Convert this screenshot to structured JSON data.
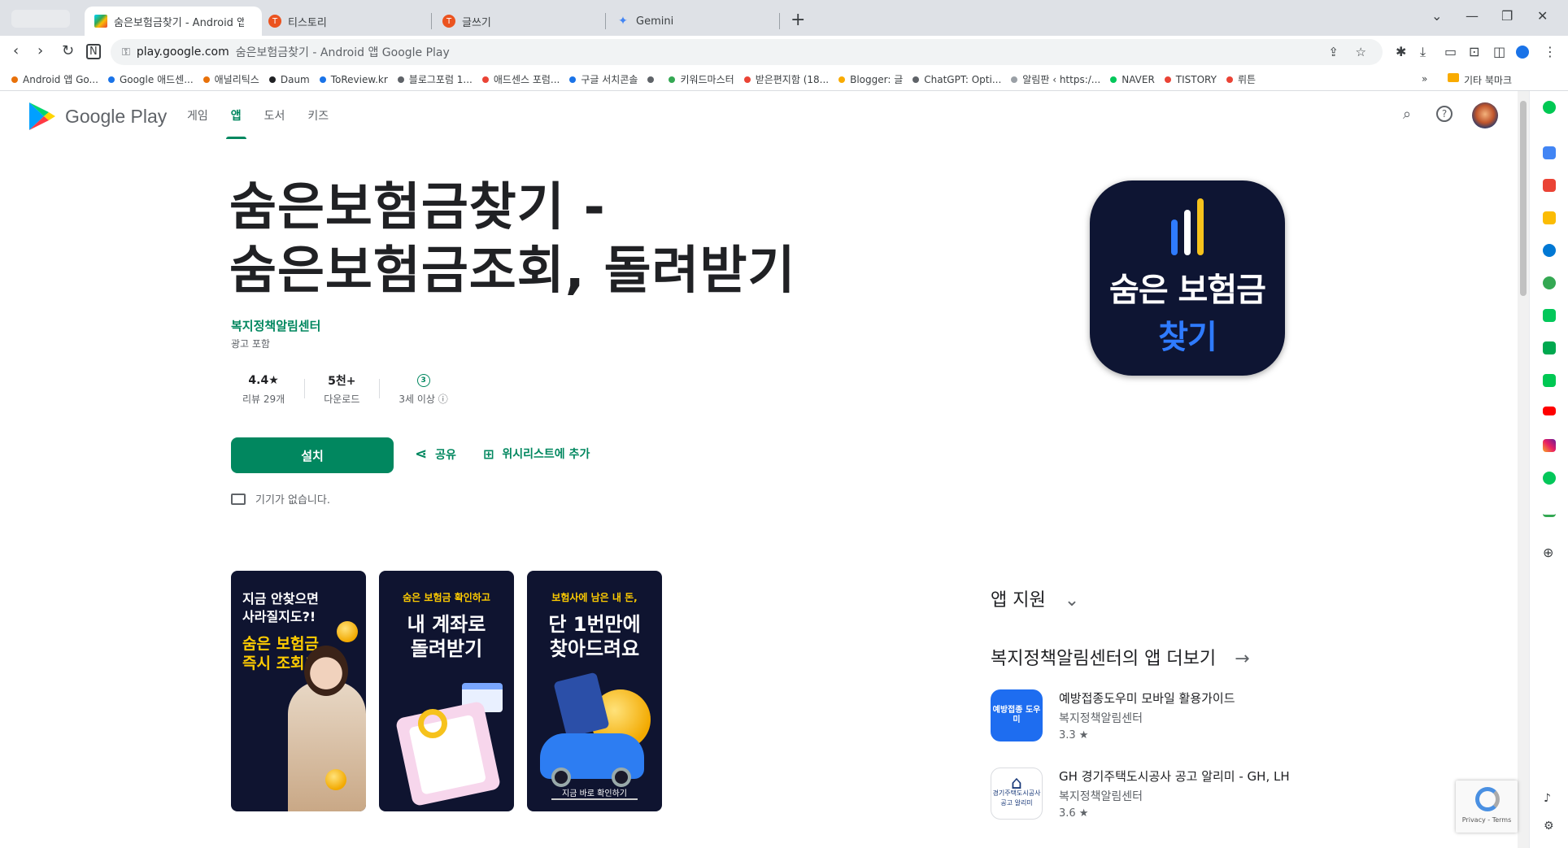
{
  "tabs": [
    {
      "title": "숨은보험금찾기 - Android 앱 Go",
      "active": true
    },
    {
      "title": "티스토리",
      "active": false
    },
    {
      "title": "글쓰기",
      "active": false
    },
    {
      "title": "Gemini",
      "active": false
    }
  ],
  "address": {
    "host": "play.google.com",
    "rest": "숨은보험금찾기 - Android 앱 Google Play"
  },
  "bookmarks": [
    {
      "label": "Android 앱 Go...",
      "color": "#e8710a"
    },
    {
      "label": "Google 애드센...",
      "color": "#1a73e8"
    },
    {
      "label": "애널리틱스",
      "color": "#e8710a"
    },
    {
      "label": "Daum",
      "color": "#202124"
    },
    {
      "label": "ToReview.kr",
      "color": "#1a73e8"
    },
    {
      "label": "블로그포럼 1...",
      "color": "#5f6368"
    },
    {
      "label": "애드센스 포럼...",
      "color": "#ea4335"
    },
    {
      "label": "구글 서치콘솔",
      "color": "#1a73e8"
    },
    {
      "label": "",
      "color": "#5f6368"
    },
    {
      "label": "키워드마스터",
      "color": "#34a853"
    },
    {
      "label": "받은편지함 (18...",
      "color": "#ea4335"
    },
    {
      "label": "Blogger: 글",
      "color": "#f9ab00"
    },
    {
      "label": "ChatGPT: Opti...",
      "color": "#5f6368"
    },
    {
      "label": "알림판 ‹ https:/...",
      "color": "#9aa0a6"
    },
    {
      "label": "NAVER",
      "color": "#03c75a"
    },
    {
      "label": "TISTORY",
      "color": "#ea4335"
    },
    {
      "label": "뤼튼",
      "color": "#ea4335"
    }
  ],
  "bookmarks_more": "»",
  "bookmarks_folder": "기타 북마크",
  "header": {
    "logo_text": "Google Play",
    "nav": [
      "게임",
      "앱",
      "도서",
      "키즈"
    ],
    "active_nav": "앱"
  },
  "app": {
    "title_line1": "숨은보험금찾기 -",
    "title_line2": "숨은보험금조회, 돌려받기",
    "developer": "복지정책알림센터",
    "contains_ads": "광고 포함",
    "rating": "4.4★",
    "reviews": "리뷰 29개",
    "downloads": "5천+",
    "downloads_label": "다운로드",
    "age_badge": "3",
    "age": "3세 이상 ⓘ",
    "install": "설치",
    "share": "공유",
    "wishlist": "위시리스트에 추가",
    "no_devices": "기기가 없습니다.",
    "icon_line1": "숨은 보험금",
    "icon_line2": "찾기"
  },
  "screenshots": [
    {
      "line1": "지금 안찾으면",
      "line2": "사라질지도?!",
      "hl1": "숨은 보험금",
      "hl2": "즉시 조회!"
    },
    {
      "sub": "숨은 보험금 확인하고",
      "big1": "내 계좌로",
      "big2": "돌려받기"
    },
    {
      "sub": "보험사에 남은 내 돈,",
      "big1": "단 1번만에",
      "big2": "찾아드려요",
      "cta": "지금 바로 확인하기"
    }
  ],
  "side": {
    "support": "앱 지원",
    "more_from": "복지정책알림센터의 앱 더보기",
    "related": [
      {
        "name": "예방접종도우미 모바일 활용가이드",
        "dev": "복지정책알림센터",
        "rating": "3.3 ★",
        "icon_text": "예방접종 도우미",
        "color": "#1e6df0"
      },
      {
        "name": "GH 경기주택도시공사 공고 알리미 - GH, LH",
        "dev": "복지정책알림센터",
        "rating": "3.6 ★",
        "icon_text": "경기주택도시공사 공고 알리미",
        "color": "#ffffff"
      }
    ]
  },
  "recaptcha": "Privacy - Terms"
}
